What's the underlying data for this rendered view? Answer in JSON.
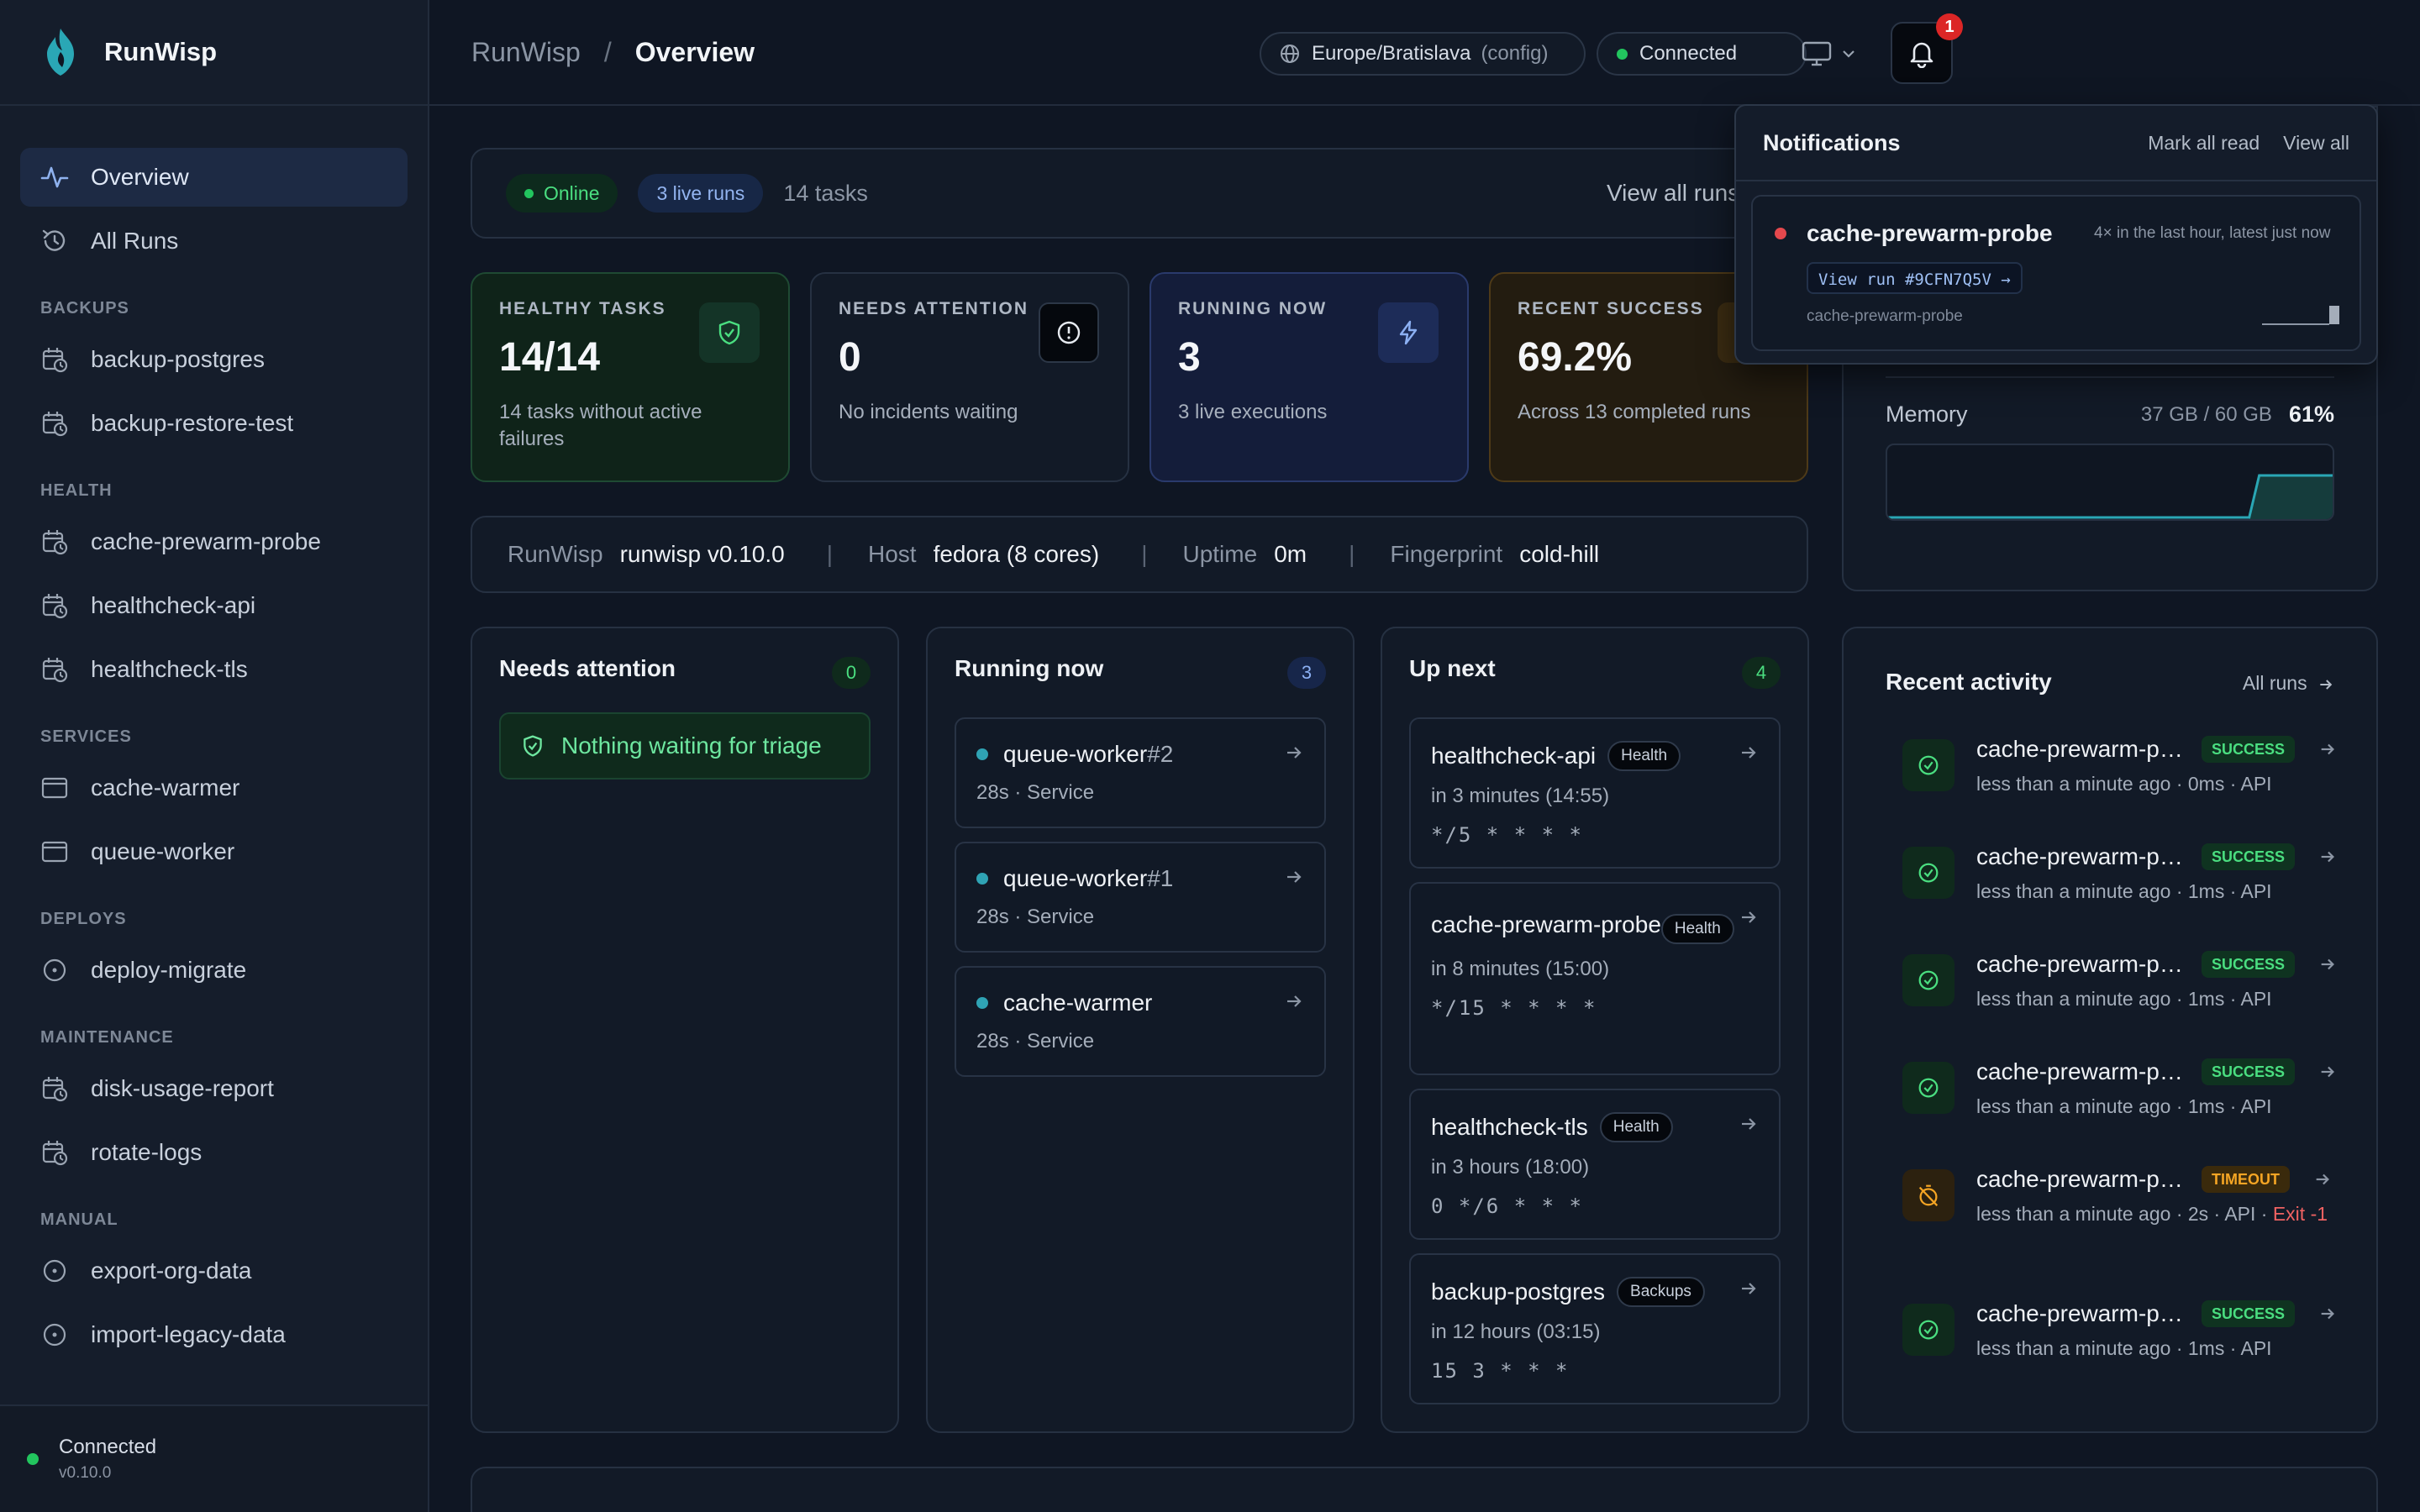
{
  "app": {
    "name": "RunWisp"
  },
  "sidebar": {
    "nav": [
      {
        "label": "Overview",
        "icon": "activity-icon",
        "active": true
      },
      {
        "label": "All Runs",
        "icon": "history-icon"
      }
    ],
    "sections": [
      {
        "title": "BACKUPS",
        "items": [
          {
            "label": "backup-postgres",
            "icon": "calendar-clock-icon"
          },
          {
            "label": "backup-restore-test",
            "icon": "calendar-clock-icon"
          }
        ]
      },
      {
        "title": "HEALTH",
        "items": [
          {
            "label": "cache-prewarm-probe",
            "icon": "calendar-clock-icon"
          },
          {
            "label": "healthcheck-api",
            "icon": "calendar-clock-icon"
          },
          {
            "label": "healthcheck-tls",
            "icon": "calendar-clock-icon"
          }
        ]
      },
      {
        "title": "SERVICES",
        "items": [
          {
            "label": "cache-warmer",
            "icon": "window-icon"
          },
          {
            "label": "queue-worker",
            "icon": "window-icon"
          }
        ]
      },
      {
        "title": "DEPLOYS",
        "items": [
          {
            "label": "deploy-migrate",
            "icon": "circle-dot-icon"
          }
        ]
      },
      {
        "title": "MAINTENANCE",
        "items": [
          {
            "label": "disk-usage-report",
            "icon": "calendar-clock-icon"
          },
          {
            "label": "rotate-logs",
            "icon": "calendar-clock-icon"
          }
        ]
      },
      {
        "title": "MANUAL",
        "items": [
          {
            "label": "export-org-data",
            "icon": "circle-dot-icon"
          },
          {
            "label": "import-legacy-data",
            "icon": "circle-dot-icon"
          }
        ]
      }
    ],
    "footer": {
      "status": "Connected",
      "version": "v0.10.0"
    }
  },
  "header": {
    "breadcrumb": {
      "root": "RunWisp",
      "separator": "/",
      "current": "Overview"
    },
    "timezone": "Europe/Bratislava",
    "timezone_note": "(config)",
    "connection": "Connected",
    "notification_count": "1"
  },
  "status_bar": {
    "online": "Online",
    "live_runs": "3 live runs",
    "tasks": "14 tasks",
    "view_all": "View all runs"
  },
  "stats": [
    {
      "label": "HEALTHY TASKS",
      "value": "14/14",
      "sub": "14 tasks without active failures",
      "icon": "shield-check-icon"
    },
    {
      "label": "NEEDS ATTENTION",
      "value": "0",
      "sub": "No incidents waiting",
      "icon": "alert-circle-icon"
    },
    {
      "label": "RUNNING NOW",
      "value": "3",
      "sub": "3 live executions",
      "icon": "zap-icon"
    },
    {
      "label": "RECENT SUCCESS",
      "value": "69.2%",
      "sub": "Across 13 completed runs",
      "icon": "trending-up-icon"
    }
  ],
  "info": {
    "app_k": "RunWisp",
    "app_v": "runwisp v0.10.0",
    "host_k": "Host",
    "host_v": "fedora (8 cores)",
    "uptime_k": "Uptime",
    "uptime_v": "0m",
    "fp_k": "Fingerprint",
    "fp_v": "cold-hill",
    "divider": "|"
  },
  "needs_attention": {
    "title": "Needs attention",
    "count": "0",
    "empty": "Nothing waiting for triage"
  },
  "running_now": {
    "title": "Running now",
    "count": "3",
    "items": [
      {
        "name": "queue-worker",
        "num": "#2",
        "meta": "28s · Service"
      },
      {
        "name": "queue-worker",
        "num": "#1",
        "meta": "28s · Service"
      },
      {
        "name": "cache-warmer",
        "num": "",
        "meta": "28s · Service"
      }
    ]
  },
  "up_next": {
    "title": "Up next",
    "count": "4",
    "items": [
      {
        "name": "healthcheck-api",
        "badge": "Health",
        "when": "in 3 minutes (14:55)",
        "cron": "*/5 * * * *"
      },
      {
        "name": "cache-prewarm-probe",
        "badge": "Health",
        "when": "in 8 minutes (15:00)",
        "cron": "*/15 * * * *"
      },
      {
        "name": "healthcheck-tls",
        "badge": "Health",
        "when": "in 3 hours (18:00)",
        "cron": "0 */6 * * *"
      },
      {
        "name": "backup-postgres",
        "badge": "Backups",
        "when": "in 12 hours (03:15)",
        "cron": "15 3 * * *"
      }
    ]
  },
  "resources": {
    "memory_label": "Memory",
    "memory_used": "37 GB / 60 GB",
    "memory_pct": "61%"
  },
  "activity": {
    "title": "Recent activity",
    "all_runs": "All runs",
    "items": [
      {
        "name": "cache-prewarm-probe",
        "status": "SUCCESS",
        "meta": "less than a minute ago · 0ms · API",
        "err": ""
      },
      {
        "name": "cache-prewarm-probe",
        "status": "SUCCESS",
        "meta": "less than a minute ago · 1ms · API",
        "err": ""
      },
      {
        "name": "cache-prewarm-probe",
        "status": "SUCCESS",
        "meta": "less than a minute ago · 1ms · API",
        "err": ""
      },
      {
        "name": "cache-prewarm-probe",
        "status": "SUCCESS",
        "meta": "less than a minute ago · 1ms · API",
        "err": ""
      },
      {
        "name": "cache-prewarm-probe",
        "status": "TIMEOUT",
        "meta": "less than a minute ago · 2s · API ·",
        "err": "Exit -1"
      },
      {
        "name": "cache-prewarm-probe",
        "status": "SUCCESS",
        "meta": "less than a minute ago · 1ms · API",
        "err": ""
      }
    ]
  },
  "notifications": {
    "title": "Notifications",
    "mark_all": "Mark all read",
    "view_all": "View all",
    "item": {
      "name": "cache-prewarm-probe",
      "when": "4× in the last hour, latest just now",
      "view_run": "View run #9CFN7Q5V →",
      "source": "cache-prewarm-probe"
    }
  },
  "colors": {
    "accent": "#22c55e",
    "danger": "#dc2626",
    "warning": "#f5a524",
    "info": "#8cb0f3"
  }
}
